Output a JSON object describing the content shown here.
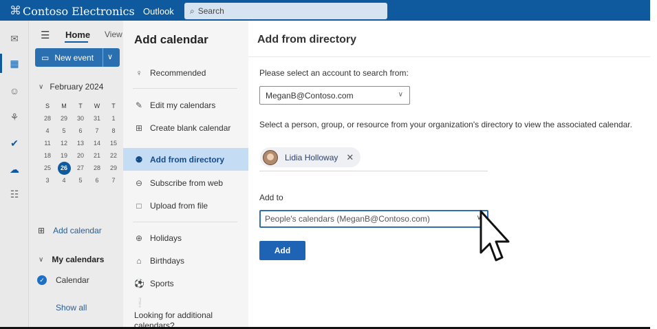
{
  "topbar": {
    "brand": "Contoso Electronics",
    "app": "Outlook",
    "search_placeholder": "Search",
    "color": "#0f5a9e"
  },
  "rail": {
    "icons": [
      "mail-icon",
      "calendar-icon",
      "people-icon",
      "groups-icon",
      "todo-icon",
      "onedrive-icon",
      "apps-icon"
    ],
    "active": "calendar-icon"
  },
  "calpane": {
    "tab_home": "Home",
    "tab_view": "View",
    "new_event": "New event",
    "month_label": "February 2024",
    "weekdays": [
      "S",
      "M",
      "T",
      "W",
      "T"
    ],
    "weeks": [
      [
        "28",
        "29",
        "30",
        "31",
        "1"
      ],
      [
        "4",
        "5",
        "6",
        "7",
        "8"
      ],
      [
        "11",
        "12",
        "13",
        "14",
        "15"
      ],
      [
        "18",
        "19",
        "20",
        "21",
        "22"
      ],
      [
        "25",
        "26",
        "27",
        "28",
        "29"
      ],
      [
        "3",
        "4",
        "5",
        "6",
        "7"
      ]
    ],
    "today": "26",
    "add_calendar": "Add calendar",
    "my_calendars": "My calendars",
    "calendar_item": "Calendar",
    "show_all": "Show all"
  },
  "dialog": {
    "title": "Add calendar",
    "nav": {
      "recommended": "Recommended",
      "edit_my_calendars": "Edit my calendars",
      "create_blank": "Create blank calendar",
      "add_from_directory": "Add from directory",
      "subscribe_web": "Subscribe from web",
      "upload_file": "Upload from file",
      "holidays": "Holidays",
      "birthdays": "Birthdays",
      "sports": "Sports",
      "looking_more": "Looking for additional calendars?"
    },
    "selected": "Add from directory",
    "main": {
      "title": "Add from directory",
      "account_prompt": "Please select an account to search from:",
      "account_value": "MeganB@Contoso.com",
      "person_prompt": "Select a person, group, or resource from your organization's directory to view the associated calendar.",
      "chip_name": "Lidia Holloway",
      "add_to_label": "Add to",
      "add_to_value": "People's calendars (MeganB@Contoso.com)",
      "add_button": "Add"
    }
  }
}
